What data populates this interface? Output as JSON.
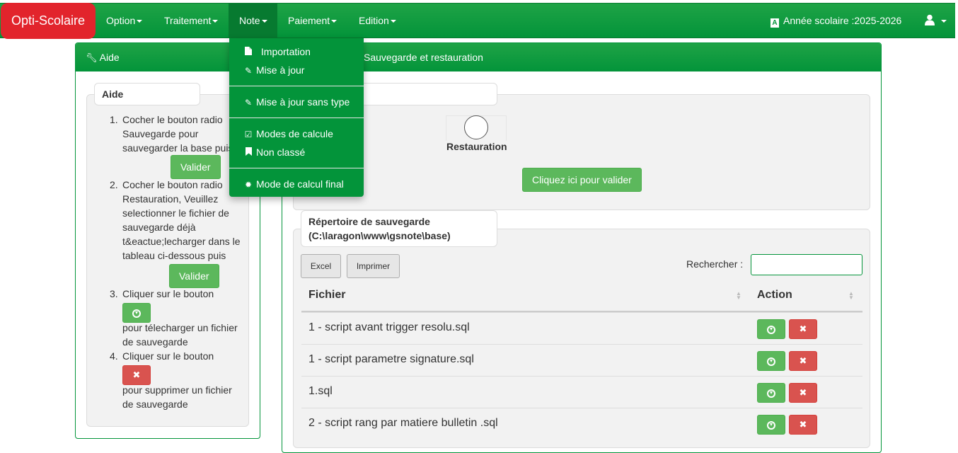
{
  "navbar": {
    "brand": "Opti-Scolaire",
    "menus": [
      "Option",
      "Traitement",
      "Note",
      "Paiement",
      "Edition"
    ],
    "school_year": "Année scolaire :2025-2026",
    "colors": {
      "brand": "#e2242c",
      "nav": "#03943a"
    }
  },
  "note_menu": {
    "items": [
      {
        "label": "Importation",
        "icon": "file-icon"
      },
      {
        "label": "Mise à jour",
        "icon": "pencil-icon"
      },
      {
        "label": "Mise à jour sans type",
        "icon": "pencil-icon"
      },
      {
        "label": "Modes de calcule",
        "icon": "check-square-icon"
      },
      {
        "label": "Non classé",
        "icon": "bookmark-icon"
      },
      {
        "label": "Mode de calcul final",
        "icon": "gear-icon"
      }
    ]
  },
  "aide_panel": {
    "title": "Aide",
    "legend": "Aide",
    "steps": [
      {
        "num": "1.",
        "text": "Cocher le bouton radio Sauvegarde pour sauvegarder la base puis cliquer sur",
        "button": "Valider"
      },
      {
        "num": "2.",
        "text": "Cocher le bouton radio Restauration, Veuillez selectionner le fichier de sauvegarde déjà t&eactue;lecharger dans le tableau ci-dessous puis clicker sur",
        "button": "Valider"
      },
      {
        "num": "3.",
        "text_before": "Cliquer sur le bouton",
        "text_after": "pour télecharger un fichier de sauvegarde"
      },
      {
        "num": "4.",
        "text_before": "Cliquer sur le bouton",
        "text_after": "pour supprimer un fichier de sauvegarde"
      }
    ]
  },
  "main_panel": {
    "title": "Sauvegarde et restauration",
    "restore_label": "Restauration",
    "validate_button": "Cliquez ici pour valider",
    "legend_line1": "Répertoire de sauvegarde",
    "legend_line2": "(C:\\laragon\\www\\gsnote\\base)",
    "excel_button": "Excel",
    "print_button": "Imprimer",
    "search_label": "Rechercher :",
    "search_value": "",
    "columns": [
      "Fichier",
      "Action"
    ],
    "rows": [
      "1 - script avant trigger resolu.sql",
      "1 - script parametre signature.sql",
      "1.sql",
      "2 - script rang par matiere bulletin .sql"
    ]
  }
}
